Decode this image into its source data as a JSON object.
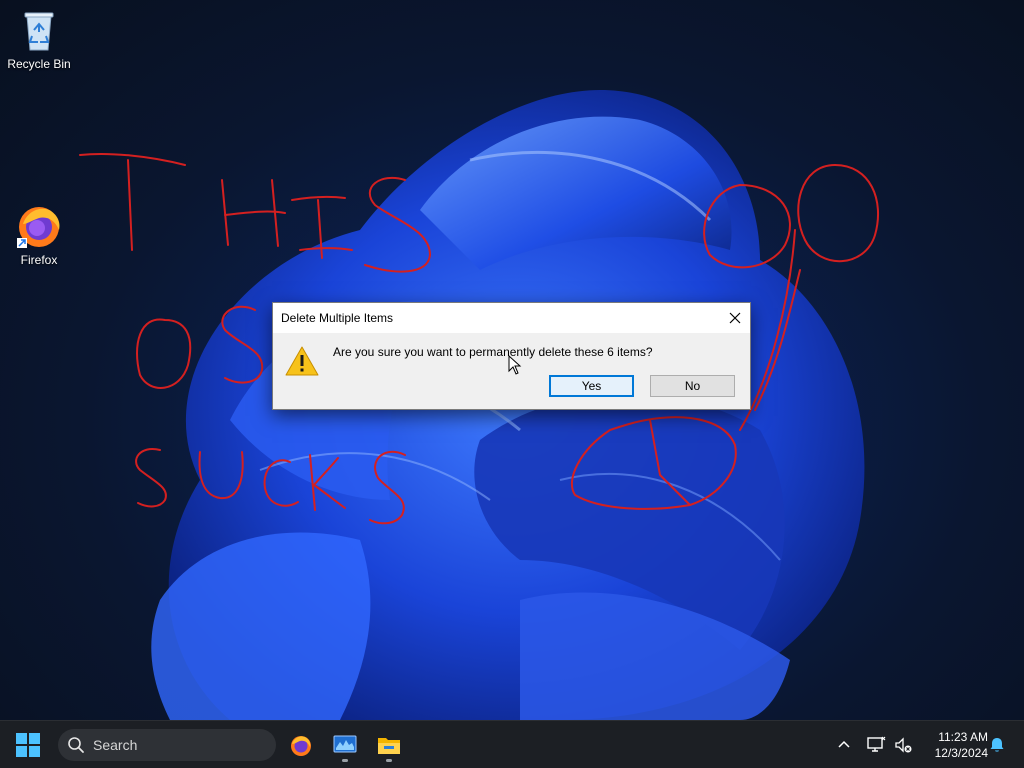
{
  "desktop": {
    "icons": [
      {
        "label": "Recycle Bin",
        "icon": "recycle-bin-icon"
      },
      {
        "label": "Firefox",
        "icon": "firefox-icon"
      }
    ],
    "scribble_color": "#d42020"
  },
  "dialog": {
    "title": "Delete Multiple Items",
    "message": "Are you sure you want to permanently delete these 6 items?",
    "yes_label": "Yes",
    "no_label": "No",
    "icon": "warning-icon",
    "close_icon": "close-icon"
  },
  "taskbar": {
    "search_placeholder": "Search",
    "pinned_apps": [
      {
        "name": "Firefox",
        "icon": "firefox-icon"
      },
      {
        "name": "Resource Monitor",
        "icon": "monitor-app-icon"
      },
      {
        "name": "File Explorer",
        "icon": "folder-icon"
      }
    ],
    "tray": {
      "time": "11:23 AM",
      "date": "12/3/2024",
      "icons": [
        "chevron-up-icon",
        "network-icon",
        "volume-muted-icon",
        "notification-bell-icon"
      ]
    },
    "accent": "#0078d7"
  }
}
